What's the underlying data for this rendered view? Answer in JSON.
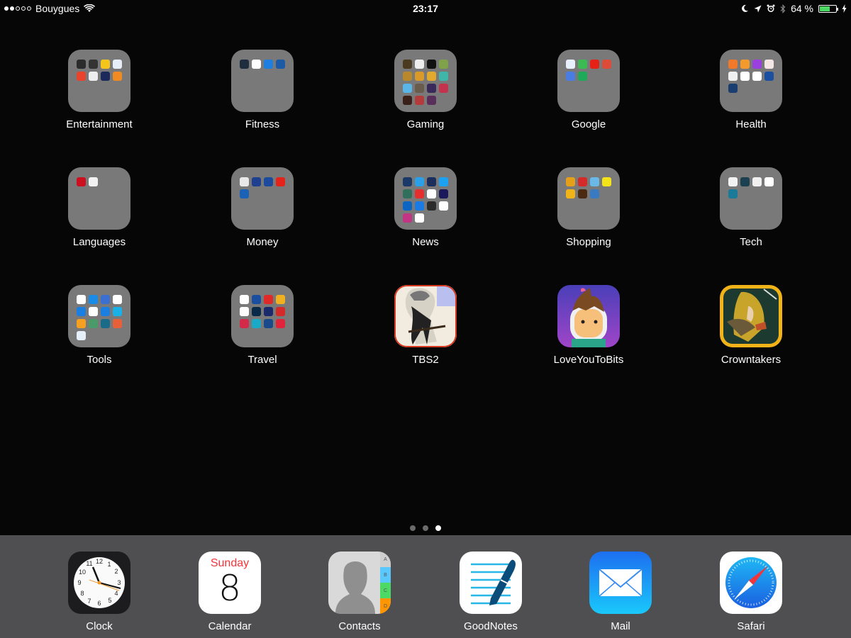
{
  "status_bar": {
    "signal_strength": "2 of 5",
    "carrier": "Bouygues",
    "time": "23:17",
    "battery_text": "64 %",
    "battery_level": 0.64,
    "icons": [
      "wifi-icon",
      "moon-icon",
      "location-icon",
      "alarm-icon",
      "bluetooth-icon",
      "battery-icon",
      "charging-icon"
    ]
  },
  "folders": [
    {
      "label": "Entertainment",
      "apps": [
        "#2b2b2b",
        "#333",
        "#f4c51b",
        "#e8eef7",
        "#e8432d",
        "#eeeeee",
        "#1b2a5b",
        "#f08a22"
      ]
    },
    {
      "label": "Fitness",
      "apps": [
        "#1e2e3e",
        "#ffffff",
        "#1e7fe0",
        "#1d5aa6"
      ]
    },
    {
      "label": "Gaming",
      "apps": [
        "#4a3a1e",
        "#eeeeee",
        "#111111",
        "#7fa24a",
        "#b8892c",
        "#d99a2a",
        "#e2a92f",
        "#3fb6a8",
        "#5ab5e8",
        "#6a5c4c",
        "#3a2a5a",
        "#c2334e",
        "#3a2018",
        "#b43b3b",
        "#5a2e5a"
      ]
    },
    {
      "label": "Google",
      "apps": [
        "#e8f0fe",
        "#3cba54",
        "#e62117",
        "#dd4b39",
        "#4a7de2",
        "#1faa59"
      ]
    },
    {
      "label": "Health",
      "apps": [
        "#f07a2a",
        "#f29a2e",
        "#9b3fe0",
        "#f5e6e6",
        "#f0f0f0",
        "#ffffff",
        "#ffffff",
        "#1c4fa0",
        "#1a3e70"
      ]
    },
    {
      "label": "Languages",
      "apps": [
        "#cc1020",
        "#f2f2f2"
      ]
    },
    {
      "label": "Money",
      "apps": [
        "#e8e8e8",
        "#1f3f8f",
        "#1c4a9c",
        "#e4231b",
        "#1b61b5"
      ]
    },
    {
      "label": "News",
      "apps": [
        "#1a3966",
        "#2b9fe8",
        "#1c2e5c",
        "#1da1f2",
        "#2f6f5c",
        "#e52e2e",
        "#ffffff",
        "#1a1a5a",
        "#0a66c2",
        "#1b7ae3",
        "#2b2b2b",
        "#ffffff",
        "#c13584",
        "#ffffff"
      ]
    },
    {
      "label": "Shopping",
      "apps": [
        "#e3a018",
        "#d42a2a",
        "#6ab8e8",
        "#f5e31a",
        "#f0b418",
        "#4a2a10",
        "#3a7ac0"
      ]
    },
    {
      "label": "Tech",
      "apps": [
        "#f2f2f2",
        "#1b4050",
        "#f0f0f0",
        "#ffffff",
        "#1a7a9a"
      ]
    },
    {
      "label": "Tools",
      "apps": [
        "#ffffff",
        "#1a8ce8",
        "#3b6fd0",
        "#ffffff",
        "#1a7fe0",
        "#ffffff",
        "#1a7fe0",
        "#1ab0e8",
        "#f5a020",
        "#4a9a6a",
        "#1a6a8a",
        "#e8603a",
        "#e6f0fa"
      ]
    },
    {
      "label": "Travel",
      "apps": [
        "#ffffff",
        "#1a4fa0",
        "#e02a2a",
        "#f0b020",
        "#ffffff",
        "#0a2a4a",
        "#1a2a6a",
        "#d42a2a",
        "#d42a4a",
        "#1aaac8",
        "#1a4a8a",
        "#e2243a"
      ]
    }
  ],
  "apps": [
    {
      "label": "TBS2",
      "icon": "tbs2-icon"
    },
    {
      "label": "LoveYouToBits",
      "icon": "loveyoutobits-icon"
    },
    {
      "label": "Crowntakers",
      "icon": "crowntakers-icon"
    }
  ],
  "page_indicator": {
    "pages": 3,
    "current": 3
  },
  "dock": {
    "clock": {
      "label": "Clock"
    },
    "calendar": {
      "label": "Calendar",
      "day": "Sunday",
      "date": "8"
    },
    "contacts": {
      "label": "Contacts",
      "tabs": [
        "A",
        "B",
        "C",
        "D"
      ]
    },
    "goodnotes": {
      "label": "GoodNotes"
    },
    "mail": {
      "label": "Mail"
    },
    "safari": {
      "label": "Safari"
    }
  }
}
